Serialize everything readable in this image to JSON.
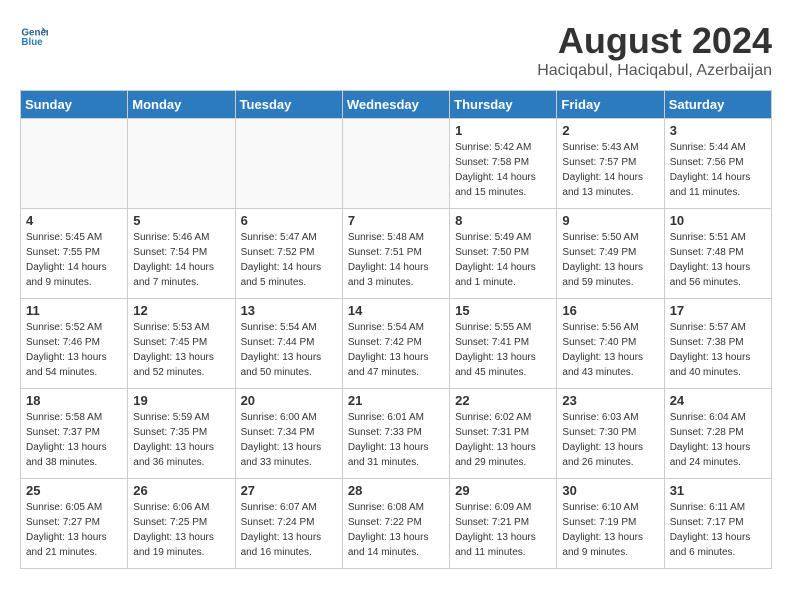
{
  "header": {
    "logo_line1": "General",
    "logo_line2": "Blue",
    "title": "August 2024",
    "subtitle": "Haciqabul, Haciqabul, Azerbaijan"
  },
  "days_of_week": [
    "Sunday",
    "Monday",
    "Tuesday",
    "Wednesday",
    "Thursday",
    "Friday",
    "Saturday"
  ],
  "weeks": [
    [
      {
        "day": "",
        "empty": true
      },
      {
        "day": "",
        "empty": true
      },
      {
        "day": "",
        "empty": true
      },
      {
        "day": "",
        "empty": true
      },
      {
        "day": "1",
        "sunrise": "Sunrise: 5:42 AM",
        "sunset": "Sunset: 7:58 PM",
        "daylight": "Daylight: 14 hours and 15 minutes."
      },
      {
        "day": "2",
        "sunrise": "Sunrise: 5:43 AM",
        "sunset": "Sunset: 7:57 PM",
        "daylight": "Daylight: 14 hours and 13 minutes."
      },
      {
        "day": "3",
        "sunrise": "Sunrise: 5:44 AM",
        "sunset": "Sunset: 7:56 PM",
        "daylight": "Daylight: 14 hours and 11 minutes."
      }
    ],
    [
      {
        "day": "4",
        "sunrise": "Sunrise: 5:45 AM",
        "sunset": "Sunset: 7:55 PM",
        "daylight": "Daylight: 14 hours and 9 minutes."
      },
      {
        "day": "5",
        "sunrise": "Sunrise: 5:46 AM",
        "sunset": "Sunset: 7:54 PM",
        "daylight": "Daylight: 14 hours and 7 minutes."
      },
      {
        "day": "6",
        "sunrise": "Sunrise: 5:47 AM",
        "sunset": "Sunset: 7:52 PM",
        "daylight": "Daylight: 14 hours and 5 minutes."
      },
      {
        "day": "7",
        "sunrise": "Sunrise: 5:48 AM",
        "sunset": "Sunset: 7:51 PM",
        "daylight": "Daylight: 14 hours and 3 minutes."
      },
      {
        "day": "8",
        "sunrise": "Sunrise: 5:49 AM",
        "sunset": "Sunset: 7:50 PM",
        "daylight": "Daylight: 14 hours and 1 minute."
      },
      {
        "day": "9",
        "sunrise": "Sunrise: 5:50 AM",
        "sunset": "Sunset: 7:49 PM",
        "daylight": "Daylight: 13 hours and 59 minutes."
      },
      {
        "day": "10",
        "sunrise": "Sunrise: 5:51 AM",
        "sunset": "Sunset: 7:48 PM",
        "daylight": "Daylight: 13 hours and 56 minutes."
      }
    ],
    [
      {
        "day": "11",
        "sunrise": "Sunrise: 5:52 AM",
        "sunset": "Sunset: 7:46 PM",
        "daylight": "Daylight: 13 hours and 54 minutes."
      },
      {
        "day": "12",
        "sunrise": "Sunrise: 5:53 AM",
        "sunset": "Sunset: 7:45 PM",
        "daylight": "Daylight: 13 hours and 52 minutes."
      },
      {
        "day": "13",
        "sunrise": "Sunrise: 5:54 AM",
        "sunset": "Sunset: 7:44 PM",
        "daylight": "Daylight: 13 hours and 50 minutes."
      },
      {
        "day": "14",
        "sunrise": "Sunrise: 5:54 AM",
        "sunset": "Sunset: 7:42 PM",
        "daylight": "Daylight: 13 hours and 47 minutes."
      },
      {
        "day": "15",
        "sunrise": "Sunrise: 5:55 AM",
        "sunset": "Sunset: 7:41 PM",
        "daylight": "Daylight: 13 hours and 45 minutes."
      },
      {
        "day": "16",
        "sunrise": "Sunrise: 5:56 AM",
        "sunset": "Sunset: 7:40 PM",
        "daylight": "Daylight: 13 hours and 43 minutes."
      },
      {
        "day": "17",
        "sunrise": "Sunrise: 5:57 AM",
        "sunset": "Sunset: 7:38 PM",
        "daylight": "Daylight: 13 hours and 40 minutes."
      }
    ],
    [
      {
        "day": "18",
        "sunrise": "Sunrise: 5:58 AM",
        "sunset": "Sunset: 7:37 PM",
        "daylight": "Daylight: 13 hours and 38 minutes."
      },
      {
        "day": "19",
        "sunrise": "Sunrise: 5:59 AM",
        "sunset": "Sunset: 7:35 PM",
        "daylight": "Daylight: 13 hours and 36 minutes."
      },
      {
        "day": "20",
        "sunrise": "Sunrise: 6:00 AM",
        "sunset": "Sunset: 7:34 PM",
        "daylight": "Daylight: 13 hours and 33 minutes."
      },
      {
        "day": "21",
        "sunrise": "Sunrise: 6:01 AM",
        "sunset": "Sunset: 7:33 PM",
        "daylight": "Daylight: 13 hours and 31 minutes."
      },
      {
        "day": "22",
        "sunrise": "Sunrise: 6:02 AM",
        "sunset": "Sunset: 7:31 PM",
        "daylight": "Daylight: 13 hours and 29 minutes."
      },
      {
        "day": "23",
        "sunrise": "Sunrise: 6:03 AM",
        "sunset": "Sunset: 7:30 PM",
        "daylight": "Daylight: 13 hours and 26 minutes."
      },
      {
        "day": "24",
        "sunrise": "Sunrise: 6:04 AM",
        "sunset": "Sunset: 7:28 PM",
        "daylight": "Daylight: 13 hours and 24 minutes."
      }
    ],
    [
      {
        "day": "25",
        "sunrise": "Sunrise: 6:05 AM",
        "sunset": "Sunset: 7:27 PM",
        "daylight": "Daylight: 13 hours and 21 minutes."
      },
      {
        "day": "26",
        "sunrise": "Sunrise: 6:06 AM",
        "sunset": "Sunset: 7:25 PM",
        "daylight": "Daylight: 13 hours and 19 minutes."
      },
      {
        "day": "27",
        "sunrise": "Sunrise: 6:07 AM",
        "sunset": "Sunset: 7:24 PM",
        "daylight": "Daylight: 13 hours and 16 minutes."
      },
      {
        "day": "28",
        "sunrise": "Sunrise: 6:08 AM",
        "sunset": "Sunset: 7:22 PM",
        "daylight": "Daylight: 13 hours and 14 minutes."
      },
      {
        "day": "29",
        "sunrise": "Sunrise: 6:09 AM",
        "sunset": "Sunset: 7:21 PM",
        "daylight": "Daylight: 13 hours and 11 minutes."
      },
      {
        "day": "30",
        "sunrise": "Sunrise: 6:10 AM",
        "sunset": "Sunset: 7:19 PM",
        "daylight": "Daylight: 13 hours and 9 minutes."
      },
      {
        "day": "31",
        "sunrise": "Sunrise: 6:11 AM",
        "sunset": "Sunset: 7:17 PM",
        "daylight": "Daylight: 13 hours and 6 minutes."
      }
    ]
  ]
}
